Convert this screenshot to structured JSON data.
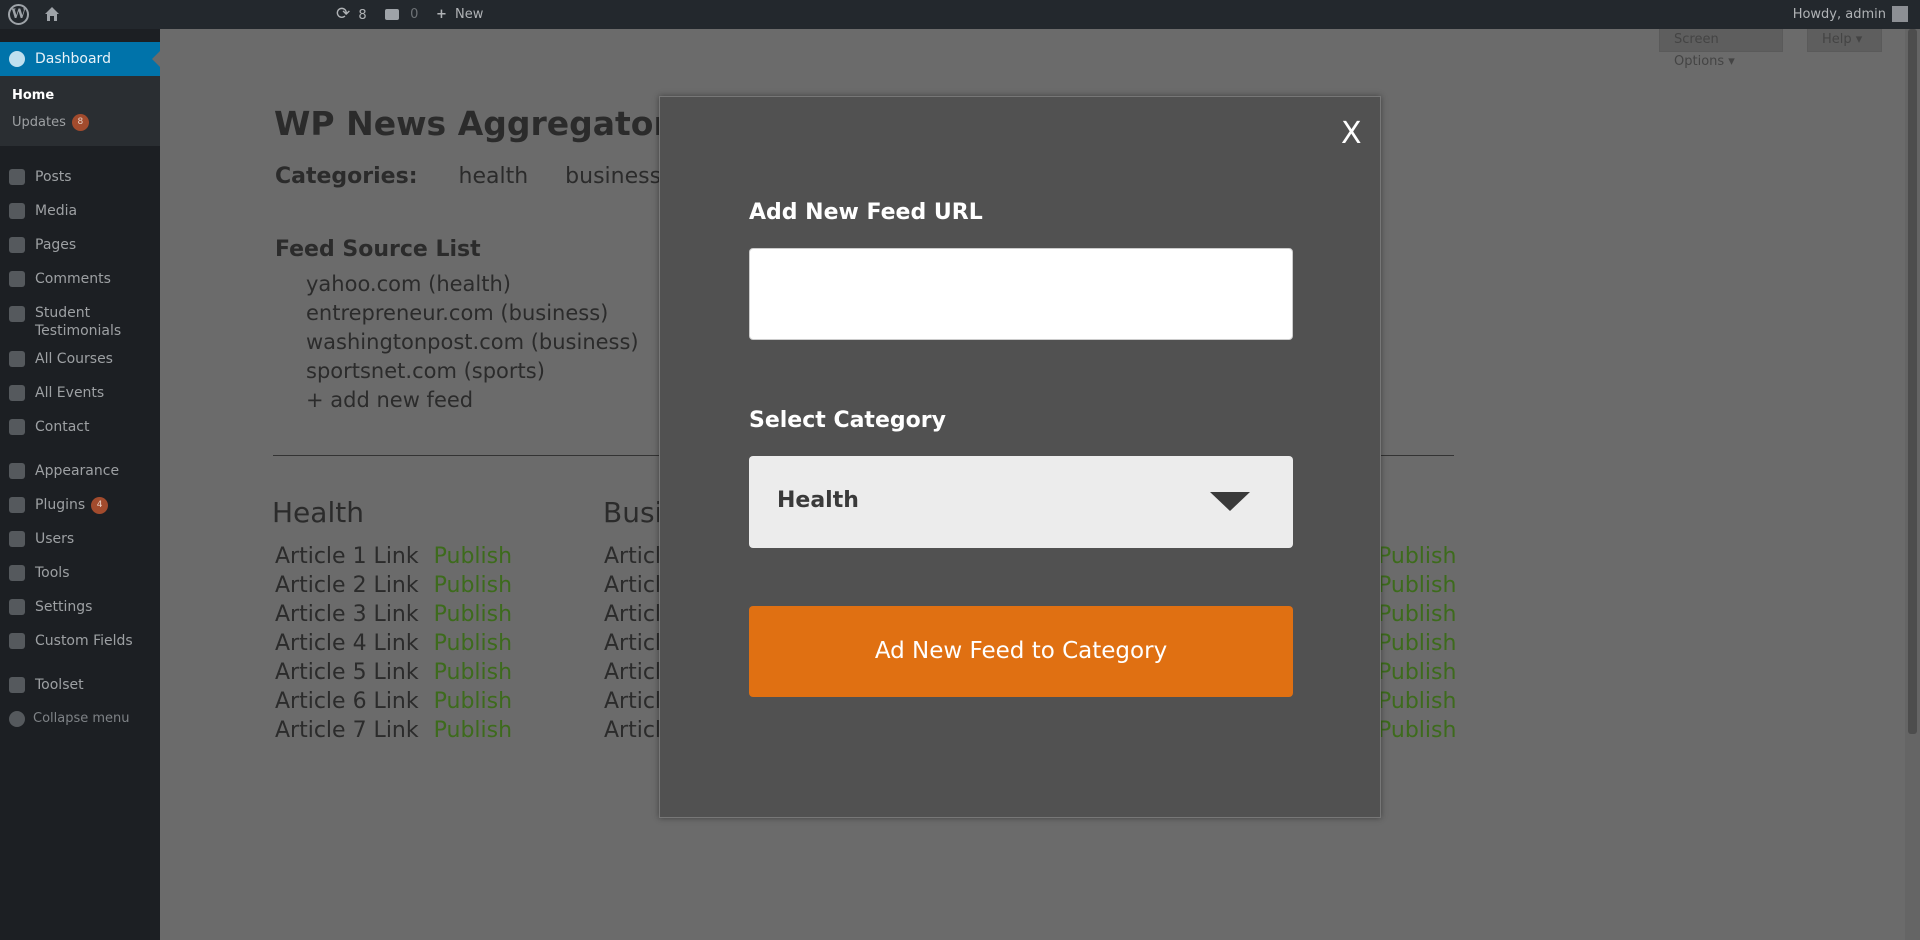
{
  "adminbar": {
    "wp_logo": "W",
    "updates_count": "8",
    "comments_count": "0",
    "new_label": "New",
    "howdy": "Howdy, admin"
  },
  "sidebar": {
    "dashboard": "Dashboard",
    "home": "Home",
    "updates": "Updates",
    "updates_badge": "8",
    "posts": "Posts",
    "media": "Media",
    "pages": "Pages",
    "comments": "Comments",
    "student_testimonials_1": "Student",
    "student_testimonials_2": "Testimonials",
    "all_courses": "All Courses",
    "all_events": "All Events",
    "contact": "Contact",
    "appearance": "Appearance",
    "plugins": "Plugins",
    "plugins_badge": "4",
    "users": "Users",
    "tools": "Tools",
    "settings": "Settings",
    "custom_fields": "Custom Fields",
    "toolset": "Toolset",
    "collapse": "Collapse menu"
  },
  "screen_options": "Screen Options ▾",
  "help": "Help ▾",
  "page": {
    "title": "WP News Aggregator",
    "categories_label": "Categories:",
    "categories": [
      "health",
      "business"
    ],
    "feed_source_title": "Feed Source List",
    "feeds": [
      "yahoo.com (health)",
      "entrepreneur.com (business)",
      "washingtonpost.com (business)",
      "sportsnet.com (sports)",
      "+ add new feed"
    ],
    "columns": [
      {
        "title": "Health"
      },
      {
        "title": "Busi"
      }
    ],
    "article_links": [
      "Article 1 Link",
      "Article 2 Link",
      "Article 3 Link",
      "Article 4 Link",
      "Article 5 Link",
      "Article 6 Link",
      "Article 7 Link"
    ],
    "business_partial": "Articl",
    "publish": "Publish"
  },
  "modal": {
    "close": "X",
    "url_label": "Add New Feed URL",
    "url_value": "",
    "category_label": "Select Category",
    "category_value": "Health",
    "submit": "Ad New Feed to Category"
  }
}
